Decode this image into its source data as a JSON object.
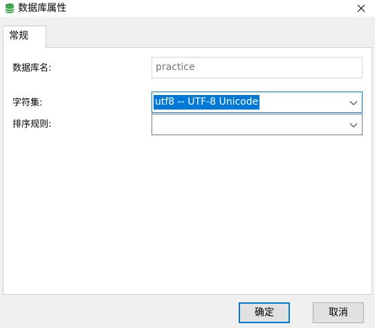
{
  "window": {
    "title": "数据库属性",
    "icon": "database-icon",
    "close_icon": "close-icon"
  },
  "tabs": [
    {
      "label": "常规",
      "active": true
    }
  ],
  "form": {
    "db_name": {
      "label": "数据库名:",
      "value": "practice"
    },
    "charset": {
      "label": "字符集:",
      "value": "utf8 -- UTF-8 Unicode"
    },
    "collation": {
      "label": "排序规则:",
      "value": ""
    }
  },
  "buttons": {
    "ok": "确定",
    "cancel": "取消"
  },
  "colors": {
    "accent": "#0078d7",
    "icon_green": "#3aa14b",
    "window_bg": "#f0f0f0",
    "panel_bg": "#ffffff"
  }
}
